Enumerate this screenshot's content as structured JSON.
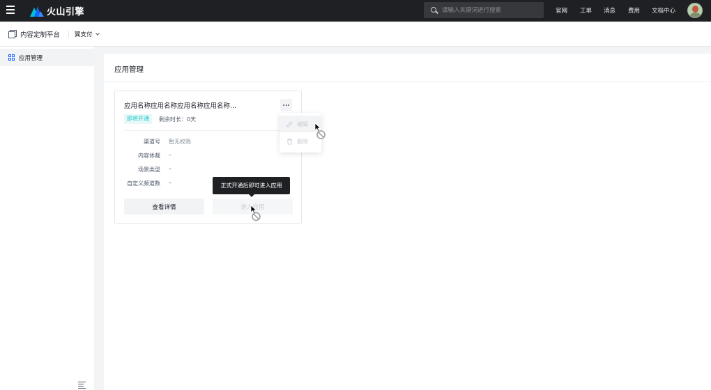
{
  "topbar": {
    "brand": "火山引擎",
    "search_placeholder": "请输入关键词进行搜索",
    "nav": [
      "官网",
      "工单",
      "消息",
      "费用",
      "文档中心"
    ]
  },
  "subheader": {
    "platform_title": "内容定制平台",
    "space_select": "翼支付"
  },
  "sidebar": {
    "items": [
      {
        "label": "应用管理",
        "active": true
      }
    ]
  },
  "main": {
    "title": "应用管理",
    "card": {
      "name": "应用名称应用名称应用名称应用名称...",
      "status": "即将开通",
      "remaining": "剩余时长：0天",
      "fields": [
        {
          "label": "渠道号",
          "value": "暂无权限"
        },
        {
          "label": "内容体裁",
          "value": "–"
        },
        {
          "label": "场景类型",
          "value": "–"
        },
        {
          "label": "自定义频道数",
          "value": "–"
        }
      ],
      "detail_button": "查看详情",
      "enter_button": "进入应用",
      "tooltip": "正式开通后即可进入应用",
      "more_menu": [
        {
          "label": "编辑",
          "icon": "edit-icon",
          "disabled": true
        },
        {
          "label": "删除",
          "icon": "trash-icon",
          "disabled": true
        }
      ]
    }
  },
  "colors": {
    "topbar_bg": "#1f2023",
    "accent": "#1664ff",
    "status_tag": "#14c9c9",
    "disabled_text": "#c9cdd4"
  }
}
